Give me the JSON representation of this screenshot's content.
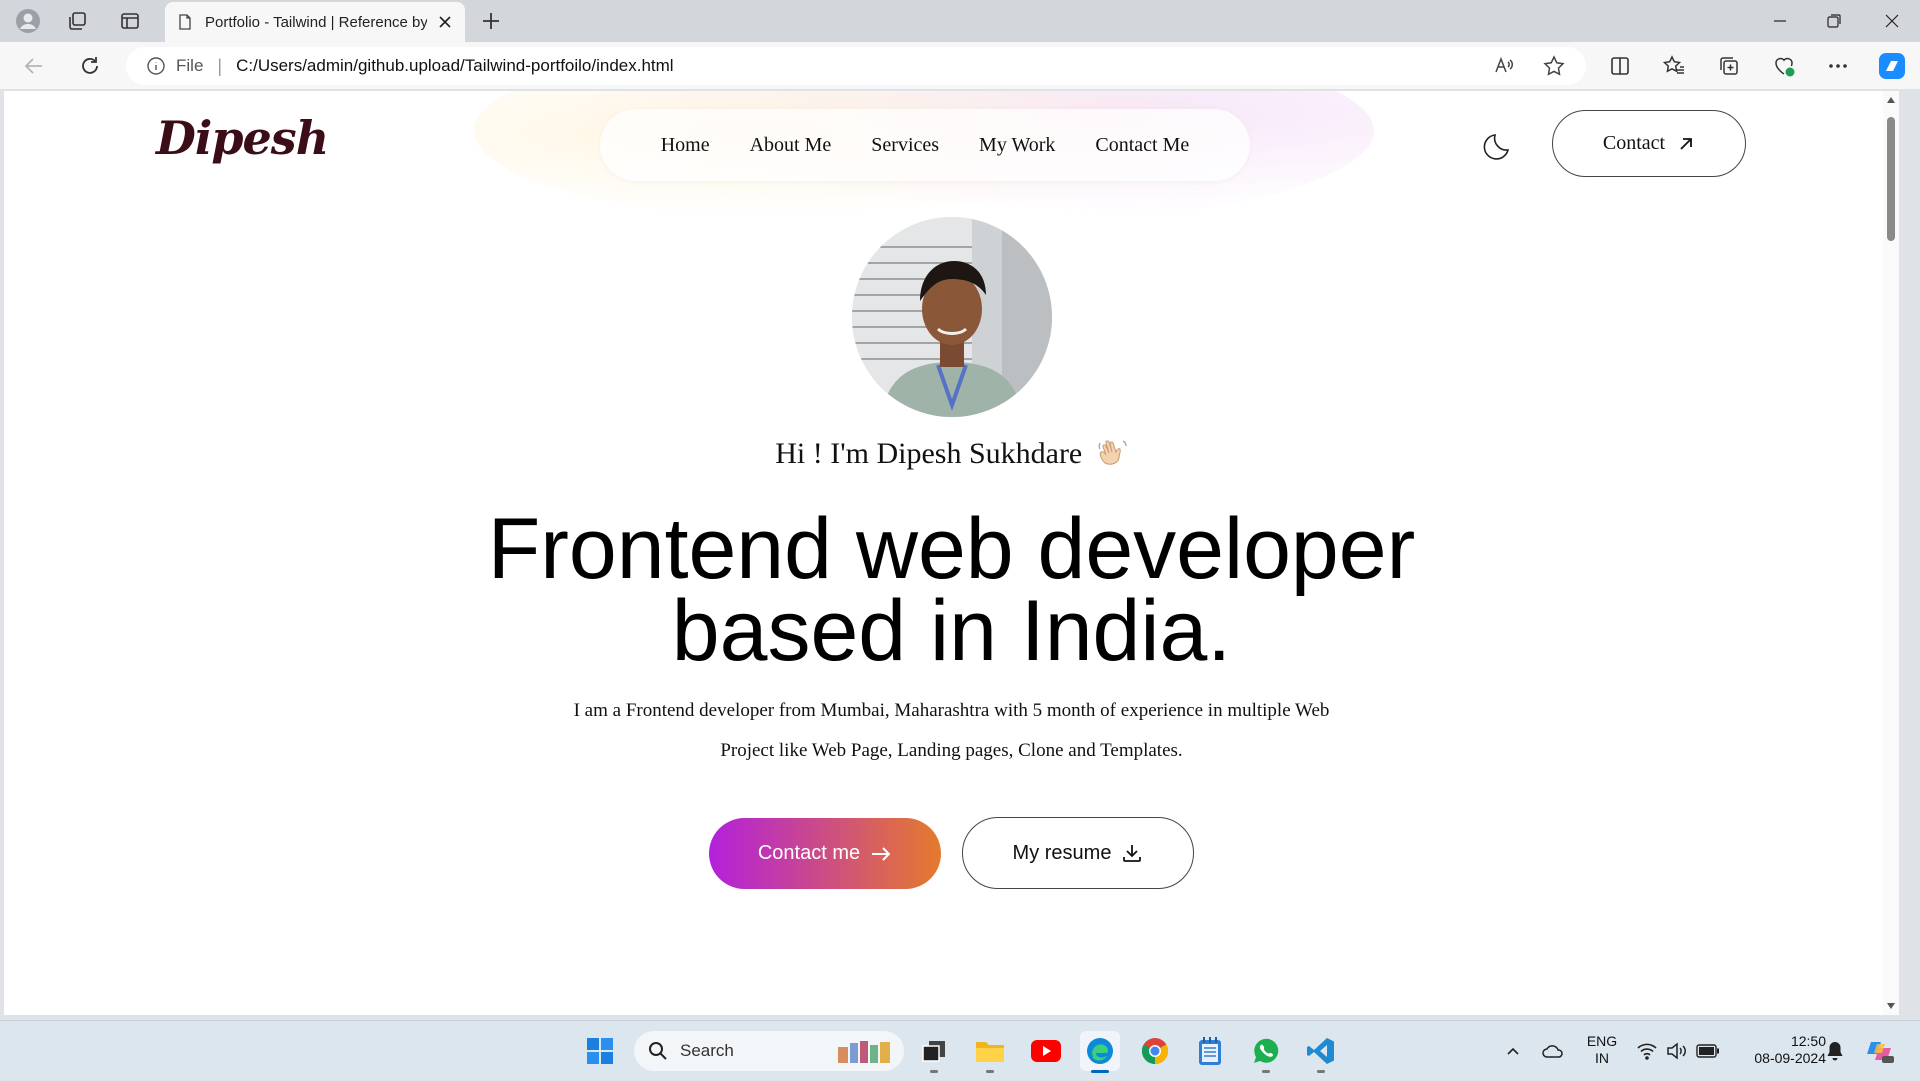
{
  "browser": {
    "tab_title": "Portfolio - Tailwind | Reference by",
    "file_label": "File",
    "separator": "|",
    "url": "C:/Users/admin/github.upload/Tailwind-portfoilo/index.html"
  },
  "site": {
    "logo": "Dipesh",
    "nav": [
      "Home",
      "About Me",
      "Services",
      "My Work",
      "Contact Me"
    ],
    "contact_button": "Contact",
    "greeting": "Hi ! I'm Dipesh Sukhdare",
    "headline_line1": "Frontend web developer",
    "headline_line2": "based in India.",
    "intro_line1": "I am a Frontend developer from Mumbai, Maharashtra with 5 month of experience in multiple Web",
    "intro_line2": "Project like Web Page, Landing pages, Clone and Templates.",
    "cta_contact": "Contact me",
    "cta_resume": "My resume",
    "colors": {
      "gradient_start": "#b320dc",
      "gradient_end": "#e57a2c",
      "logo": "#3b0d16"
    }
  },
  "taskbar": {
    "search_placeholder": "Search",
    "lang_line1": "ENG",
    "lang_line2": "IN",
    "time": "12:50",
    "date": "08-09-2024"
  }
}
